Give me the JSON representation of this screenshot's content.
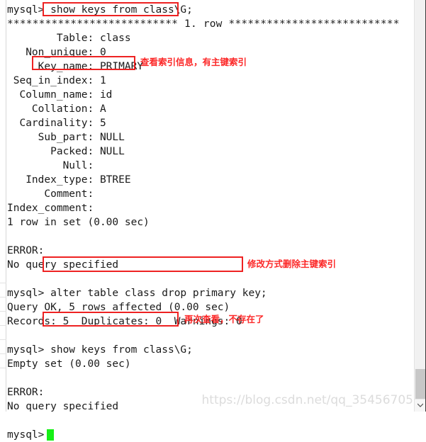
{
  "window": {
    "title": "MySQL command line terminal output",
    "background_color": "#ffffff",
    "text_color": "#1a1a1a",
    "highlight_color": "#ee2222",
    "annotation_color": "#fc2828",
    "cursor_color": "#16f016"
  },
  "terminal": {
    "lines": [
      {
        "id": "l01",
        "text": "mysql> show keys from class\\G;"
      },
      {
        "id": "l02",
        "text": "*************************** 1. row ***************************"
      },
      {
        "id": "l03",
        "text": "        Table: class"
      },
      {
        "id": "l04",
        "text": "   Non_unique: 0"
      },
      {
        "id": "l05",
        "text": "     Key_name: PRIMARY"
      },
      {
        "id": "l06",
        "text": " Seq_in_index: 1"
      },
      {
        "id": "l07",
        "text": "  Column_name: id"
      },
      {
        "id": "l08",
        "text": "    Collation: A"
      },
      {
        "id": "l09",
        "text": "  Cardinality: 5"
      },
      {
        "id": "l10",
        "text": "     Sub_part: NULL"
      },
      {
        "id": "l11",
        "text": "       Packed: NULL"
      },
      {
        "id": "l12",
        "text": "         Null:"
      },
      {
        "id": "l13",
        "text": "   Index_type: BTREE"
      },
      {
        "id": "l14",
        "text": "      Comment:"
      },
      {
        "id": "l15",
        "text": "Index_comment:"
      },
      {
        "id": "l16",
        "text": "1 row in set (0.00 sec)"
      },
      {
        "id": "l17",
        "text": ""
      },
      {
        "id": "l18",
        "text": "ERROR:"
      },
      {
        "id": "l19",
        "text": "No query specified"
      },
      {
        "id": "l20",
        "text": ""
      },
      {
        "id": "l21",
        "text": "mysql> alter table class drop primary key;"
      },
      {
        "id": "l22",
        "text": "Query OK, 5 rows affected (0.00 sec)"
      },
      {
        "id": "l23",
        "text": "Records: 5  Duplicates: 0  Warnings: 0"
      },
      {
        "id": "l24",
        "text": ""
      },
      {
        "id": "l25",
        "text": "mysql> show keys from class\\G;"
      },
      {
        "id": "l26",
        "text": "Empty set (0.00 sec)"
      },
      {
        "id": "l27",
        "text": ""
      },
      {
        "id": "l28",
        "text": "ERROR:"
      },
      {
        "id": "l29",
        "text": "No query specified"
      },
      {
        "id": "l30",
        "text": ""
      },
      {
        "id": "l31",
        "text": "mysql>"
      }
    ]
  },
  "annotations": [
    {
      "id": "a1",
      "text": "查看索引信息，有主键索引"
    },
    {
      "id": "a2",
      "text": "修改方式删除主键索引"
    },
    {
      "id": "a3",
      "text": "再次查看，不存在了"
    }
  ],
  "highlights": [
    {
      "id": "h1",
      "target": "show keys from class\\G;"
    },
    {
      "id": "h2",
      "target": "Key_name: PRIMARY"
    },
    {
      "id": "h3",
      "target": "alter table class drop primary key;"
    },
    {
      "id": "h4",
      "target": "show keys from class\\G;"
    }
  ],
  "watermark": {
    "text": "https://blog.csdn.net/qq_35456705"
  },
  "scrollbar": {
    "down_arrow": "chevron-down-icon"
  }
}
